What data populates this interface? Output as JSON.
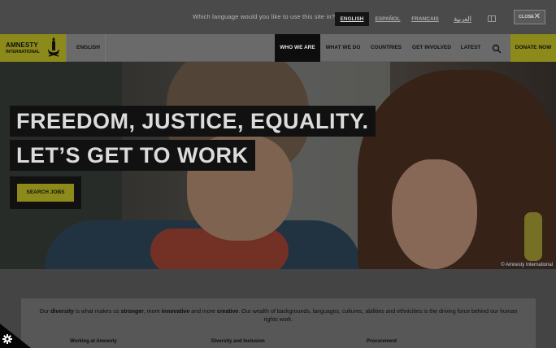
{
  "language_bar": {
    "prompt": "Which language would you like to use this site in?",
    "languages": [
      {
        "label": "ENGLISH",
        "active": true
      },
      {
        "label": "ESPAÑOL",
        "active": false
      },
      {
        "label": "FRANÇAIS",
        "active": false
      },
      {
        "label": "العربية",
        "active": false
      }
    ],
    "close_label": "CLOSE",
    "close_symbol": "✕"
  },
  "nav": {
    "logo_line1": "AMNESTY",
    "logo_line2": "INTERNATIONAL",
    "language_label": "ENGLISH",
    "items": [
      {
        "label": "WHO WE ARE",
        "active": true
      },
      {
        "label": "WHAT WE DO",
        "active": false
      },
      {
        "label": "COUNTRIES",
        "active": false
      },
      {
        "label": "GET INVOLVED",
        "active": false
      },
      {
        "label": "LATEST",
        "active": false
      }
    ],
    "search_icon": "search-icon",
    "donate_label": "DONATE NOW",
    "brand_color": "#8c8a1a"
  },
  "hero": {
    "headline_line1": "FREEDOM, JUSTICE, EQUALITY.",
    "headline_line2": "LET’S GET TO WORK",
    "button_label": "SEARCH JOBS",
    "credit": "© Amnesty International"
  },
  "intro": {
    "parts": [
      {
        "text": "Our ",
        "bold": false
      },
      {
        "text": "diversity",
        "bold": true
      },
      {
        "text": " is what makes us ",
        "bold": false
      },
      {
        "text": "stronger",
        "bold": true
      },
      {
        "text": ", more ",
        "bold": false
      },
      {
        "text": "innovative",
        "bold": true
      },
      {
        "text": " and more ",
        "bold": false
      },
      {
        "text": "creative",
        "bold": true
      },
      {
        "text": ". Our wealth of backgrounds, languages, cultures, abilities and ethnicities is the driving force behind our human rights work.",
        "bold": false
      }
    ],
    "links": [
      "Working at Amnesty",
      "Diversity and Inclusion",
      "Procurement"
    ]
  },
  "cookie": {
    "icon": "gear-icon"
  }
}
